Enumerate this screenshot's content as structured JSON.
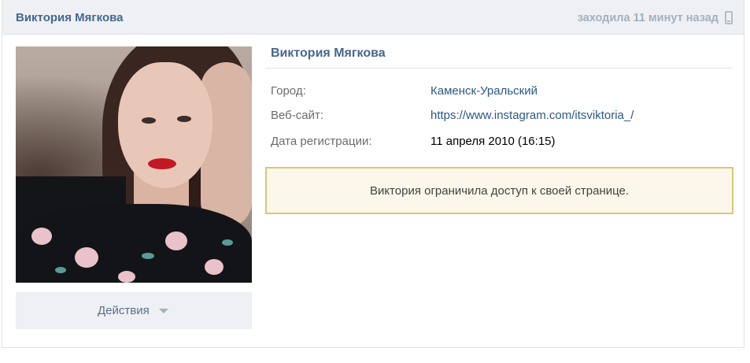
{
  "header": {
    "name": "Виктория Мягкова",
    "status": "заходила 11 минут назад",
    "status_icon": "mobile-phone-icon"
  },
  "profile": {
    "name": "Виктория Мягкова",
    "photo_icon": "profile-photo",
    "info": [
      {
        "label": "Город:",
        "value": "Каменск-Уральский",
        "kind": "link"
      },
      {
        "label": "Веб-сайт:",
        "value": "https://www.instagram.com/itsviktoria_/",
        "kind": "link"
      },
      {
        "label": "Дата регистрации:",
        "value": "11 апреля 2010 (16:15)",
        "kind": "plain"
      }
    ],
    "notice": "Виктория ограничила доступ к своей странице."
  },
  "actions": {
    "label": "Действия",
    "icon": "caret-down-icon"
  },
  "colors": {
    "accent": "#45678f",
    "link": "#2a5885",
    "header_bg": "#eef0f3",
    "notice_bg": "#fbf7ea",
    "notice_border": "#e1c472"
  }
}
